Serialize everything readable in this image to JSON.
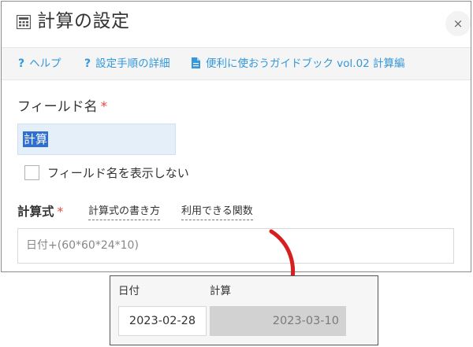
{
  "dialog": {
    "title": "計算の設定",
    "close_label": "×",
    "links": [
      {
        "q": "?",
        "label": "ヘルプ"
      },
      {
        "q": "?",
        "label": "設定手順の詳細"
      },
      {
        "label": "便利に使おうガイドブック vol.02 計算編"
      }
    ],
    "field_name_label": "フィールド名",
    "required_mark": "*",
    "field_name_value": "計算",
    "hide_name_checkbox_label": "フィールド名を表示しない",
    "hide_name_checked": false,
    "formula_label": "計算式",
    "formula_help_link": "計算式の書き方",
    "functions_link": "利用できる関数",
    "formula_value": "日付+(60*60*24*10)"
  },
  "preview": {
    "date_label": "日付",
    "date_value": "2023-02-28",
    "result_label": "計算",
    "result_value": "2023-03-10"
  },
  "colors": {
    "link": "#3498db",
    "required": "#e74c3c",
    "arrow": "#d61f1f",
    "selection": "#2f6fd0"
  }
}
